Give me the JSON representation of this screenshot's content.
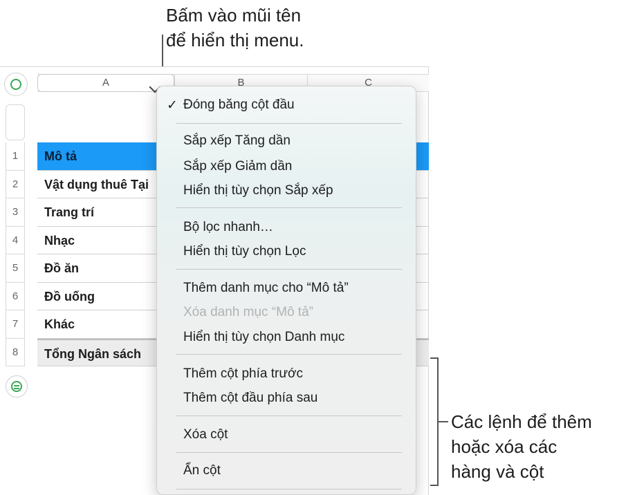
{
  "callouts": {
    "top_line1": "Bấm vào mũi tên",
    "top_line2": "để hiển thị menu.",
    "right_line1": "Các lệnh để thêm",
    "right_line2": "hoặc xóa các",
    "right_line3": "hàng và cột"
  },
  "sheet": {
    "columns": [
      "A",
      "B",
      "C"
    ],
    "row_numbers": [
      "1",
      "2",
      "3",
      "4",
      "5",
      "6",
      "7",
      "8"
    ],
    "rows": [
      "Mô tả",
      "Vật dụng thuê Tại",
      "Trang trí",
      "Nhạc",
      "Đồ ăn",
      "Đồ uống",
      "Khác",
      "Tổng Ngân sách"
    ]
  },
  "menu": {
    "check_mark": "✓",
    "freeze": "Đóng băng cột đầu",
    "sort_asc": "Sắp xếp Tăng dần",
    "sort_desc": "Sắp xếp Giảm dần",
    "sort_options": "Hiển thị tùy chọn Sắp xếp",
    "quick_filter": "Bộ lọc nhanh…",
    "filter_options": "Hiển thị tùy chọn Lọc",
    "add_category": "Thêm danh mục cho “Mô tả”",
    "delete_category": "Xóa danh mục “Mô tả”",
    "category_options": "Hiển thị tùy chọn Danh mục",
    "add_column_before": "Thêm cột phía trước",
    "add_column_after": "Thêm cột đầu phía sau",
    "delete_column": "Xóa cột",
    "hide_column": "Ẩn cột"
  },
  "colors": {
    "header_row": "#1b9af7",
    "accent_green": "#3aa757"
  }
}
